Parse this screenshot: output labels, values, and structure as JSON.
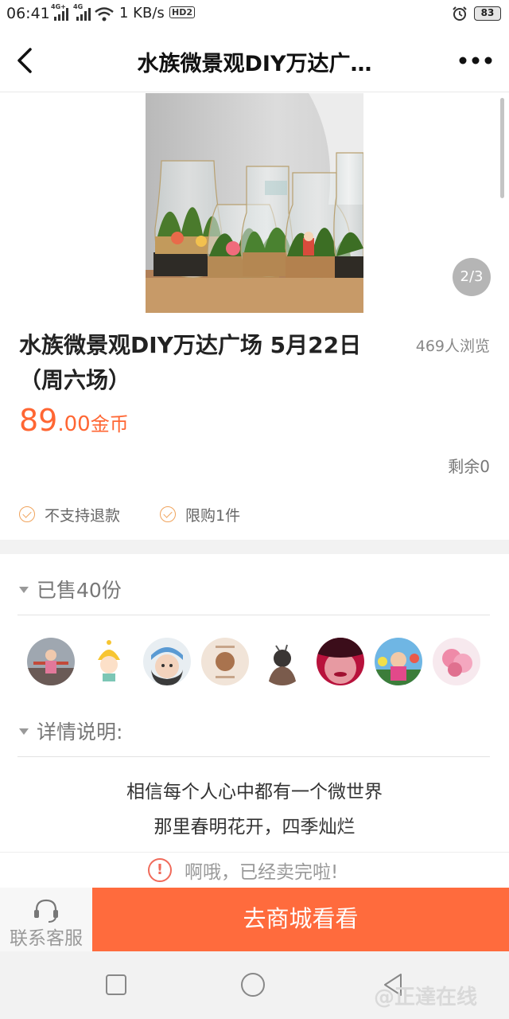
{
  "status_bar": {
    "time": "06:41",
    "network_1": "4G+",
    "network_2": "4G",
    "speed": "1 KB/s",
    "hd": "HD2",
    "battery": "83"
  },
  "nav": {
    "title": "水族微景观DIY万达广…",
    "back_icon": "chevron-left-icon",
    "more_icon": "more-horizontal-icon"
  },
  "gallery": {
    "page_indicator": "2/3",
    "image_description_icon": "aquarium-jars-photo"
  },
  "product": {
    "title": "水族微景观DIY万达广场 5月22日（周六场）",
    "views": "469人浏览",
    "price_int": "89",
    "price_dec": ".00",
    "price_unit": "金币",
    "stock": "剩余0",
    "tags": [
      "不支持退款",
      "限购1件"
    ]
  },
  "sold": {
    "heading": "已售40份"
  },
  "details": {
    "heading": "详情说明:",
    "lines": [
      "相信每个人心中都有一个微世界",
      "那里春明花开，四季灿烂"
    ]
  },
  "soldout_notice": "啊哦，已经卖完啦!",
  "bottom": {
    "service_label": "联系客服",
    "mall_label": "去商城看看"
  },
  "watermark": "@正達在线",
  "colors": {
    "accent": "#ff6b3d",
    "price": "#ff6633",
    "check": "#f0a35c",
    "warn": "#f06a5a"
  }
}
